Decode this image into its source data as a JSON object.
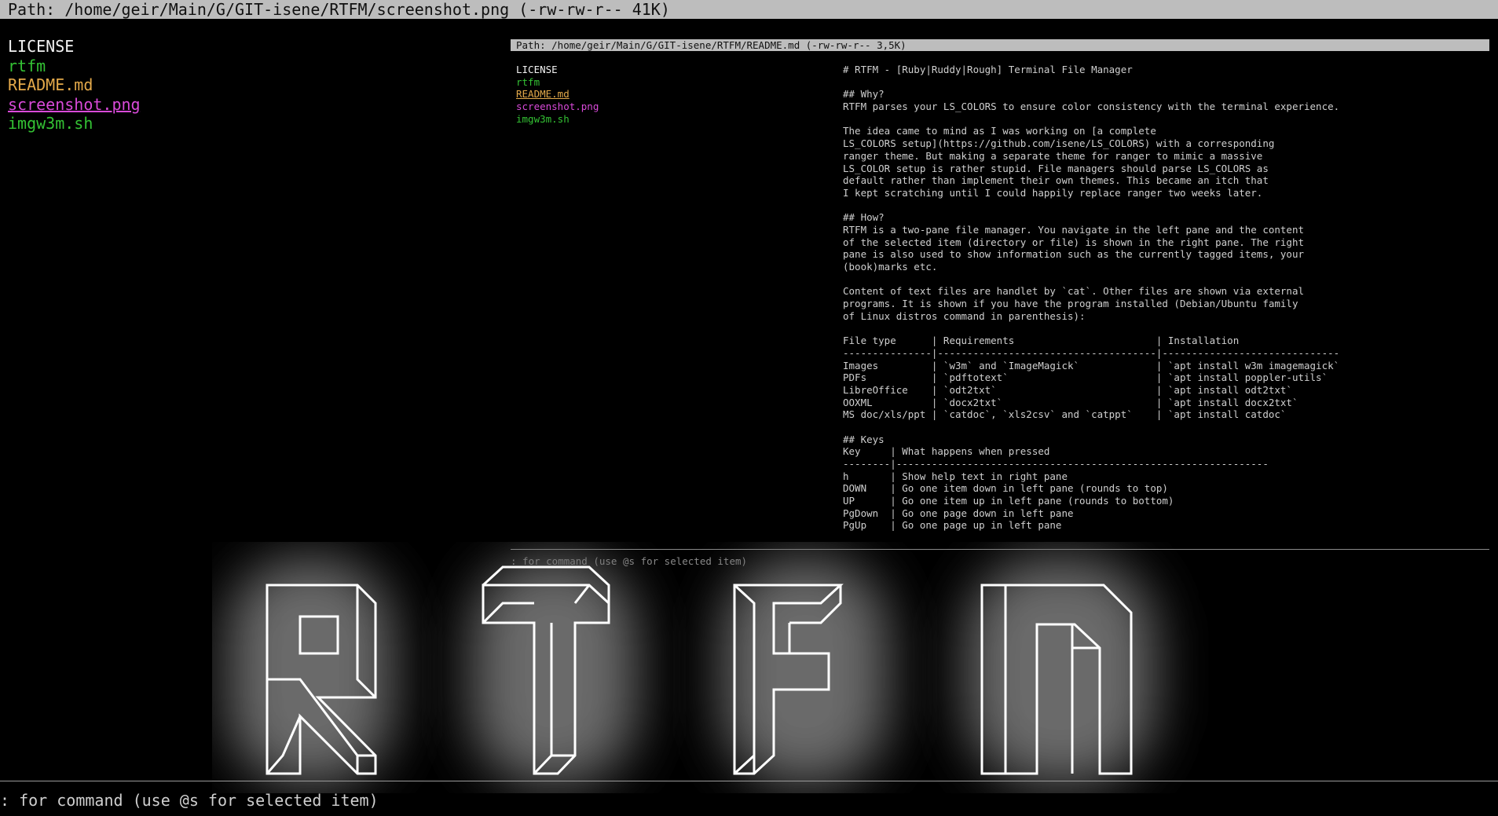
{
  "top_bar": {
    "text": "Path: /home/geir/Main/G/GIT-isene/RTFM/screenshot.png (-rw-rw-r-- 41K)"
  },
  "left_pane": {
    "files": [
      {
        "name": "LICENSE",
        "color": "#f2f2f2"
      },
      {
        "name": "rtfm",
        "color": "#34c234"
      },
      {
        "name": "README.md",
        "color": "#e3a94a"
      },
      {
        "name": "screenshot.png",
        "color": "#d94ad9"
      },
      {
        "name": "imgw3m.sh",
        "color": "#34c234"
      }
    ]
  },
  "preview": {
    "path_bar": "Path: /home/geir/Main/G/GIT-isene/RTFM/README.md (-rw-rw-r-- 3,5K)",
    "files": [
      "LICENSE",
      "rtfm",
      "README.md",
      "screenshot.png",
      "imgw3m.sh"
    ],
    "readme_lines": [
      "# RTFM - [Ruby|Ruddy|Rough] Terminal File Manager",
      "",
      "## Why?",
      "RTFM parses your LS_COLORS to ensure color consistency with the terminal experience.",
      "",
      "The idea came to mind as I was working on [a complete",
      "LS_COLORS setup](https://github.com/isene/LS_COLORS) with a corresponding",
      "ranger theme. But making a separate theme for ranger to mimic a massive",
      "LS_COLOR setup is rather stupid. File managers should parse LS_COLORS as",
      "default rather than implement their own themes. This became an itch that",
      "I kept scratching until I could happily replace ranger two weeks later.",
      "",
      "## How?",
      "RTFM is a two-pane file manager. You navigate in the left pane and the content",
      "of the selected item (directory or file) is shown in the right pane. The right",
      "pane is also used to show information such as the currently tagged items, your",
      "(book)marks etc.",
      "",
      "Content of text files are handlet by `cat`. Other files are shown via external",
      "programs. It is shown if you have the program installed (Debian/Ubuntu family",
      "of Linux distros command in parenthesis):",
      "",
      "File type      | Requirements                        | Installation",
      "---------------|-------------------------------------|------------------------------",
      "Images         | `w3m` and `ImageMagick`             | `apt install w3m imagemagick`",
      "PDFs           | `pdftotext`                         | `apt install poppler-utils`",
      "LibreOffice    | `odt2txt`                           | `apt install odt2txt`",
      "OOXML          | `docx2txt`                          | `apt install docx2txt`",
      "MS doc/xls/ppt | `catdoc`, `xls2csv` and `catppt`    | `apt install catdoc`",
      "",
      "## Keys",
      "Key     | What happens when pressed",
      "--------|---------------------------------------------------------------",
      "h       | Show help text in right pane",
      "DOWN    | Go one item down in left pane (rounds to top)",
      "UP      | Go one item up in left pane (rounds to bottom)",
      "PgDown  | Go one page down in left pane",
      "PgUp    | Go one page up in left pane"
    ],
    "command_hint": ": for command (use @s for selected item)"
  },
  "logo": {
    "letters": [
      "R",
      "T",
      "F",
      "M"
    ]
  },
  "command_line": {
    "text": ": for command (use @s for selected item)"
  }
}
